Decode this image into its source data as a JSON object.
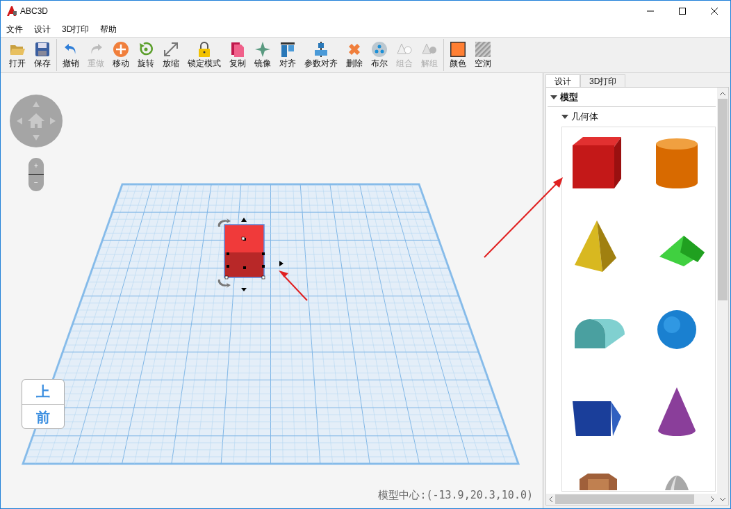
{
  "window": {
    "title": "ABC3D"
  },
  "menu": [
    "文件",
    "设计",
    "3D打印",
    "帮助"
  ],
  "toolbar": [
    [
      {
        "label": "打开",
        "disabled": false
      },
      {
        "label": "保存",
        "disabled": false
      }
    ],
    [
      {
        "label": "撤销",
        "disabled": false
      },
      {
        "label": "重做",
        "disabled": true
      },
      {
        "label": "移动",
        "disabled": false
      },
      {
        "label": "旋转",
        "disabled": false
      },
      {
        "label": "放缩",
        "disabled": false
      },
      {
        "label": "锁定模式",
        "disabled": false
      },
      {
        "label": "复制",
        "disabled": false
      },
      {
        "label": "镜像",
        "disabled": false
      },
      {
        "label": "对齐",
        "disabled": false
      },
      {
        "label": "参数对齐",
        "disabled": false
      },
      {
        "label": "删除",
        "disabled": false
      },
      {
        "label": "布尔",
        "disabled": false
      },
      {
        "label": "组合",
        "disabled": true
      },
      {
        "label": "解组",
        "disabled": true
      }
    ],
    [
      {
        "label": "颜色",
        "disabled": false
      },
      {
        "label": "空洞",
        "disabled": false
      }
    ]
  ],
  "viewport": {
    "zoom": [
      "+",
      "−"
    ],
    "view_cube": [
      "上",
      "前"
    ],
    "status": "模型中心:(-13.9,20.3,10.0)"
  },
  "panel": {
    "tabs": [
      {
        "label": "设计",
        "selected": true
      },
      {
        "label": "3D打印",
        "selected": false
      }
    ],
    "tree": [
      {
        "label": "模型",
        "expanded": true,
        "children": [
          {
            "label": "几何体",
            "expanded": true
          }
        ]
      }
    ]
  }
}
